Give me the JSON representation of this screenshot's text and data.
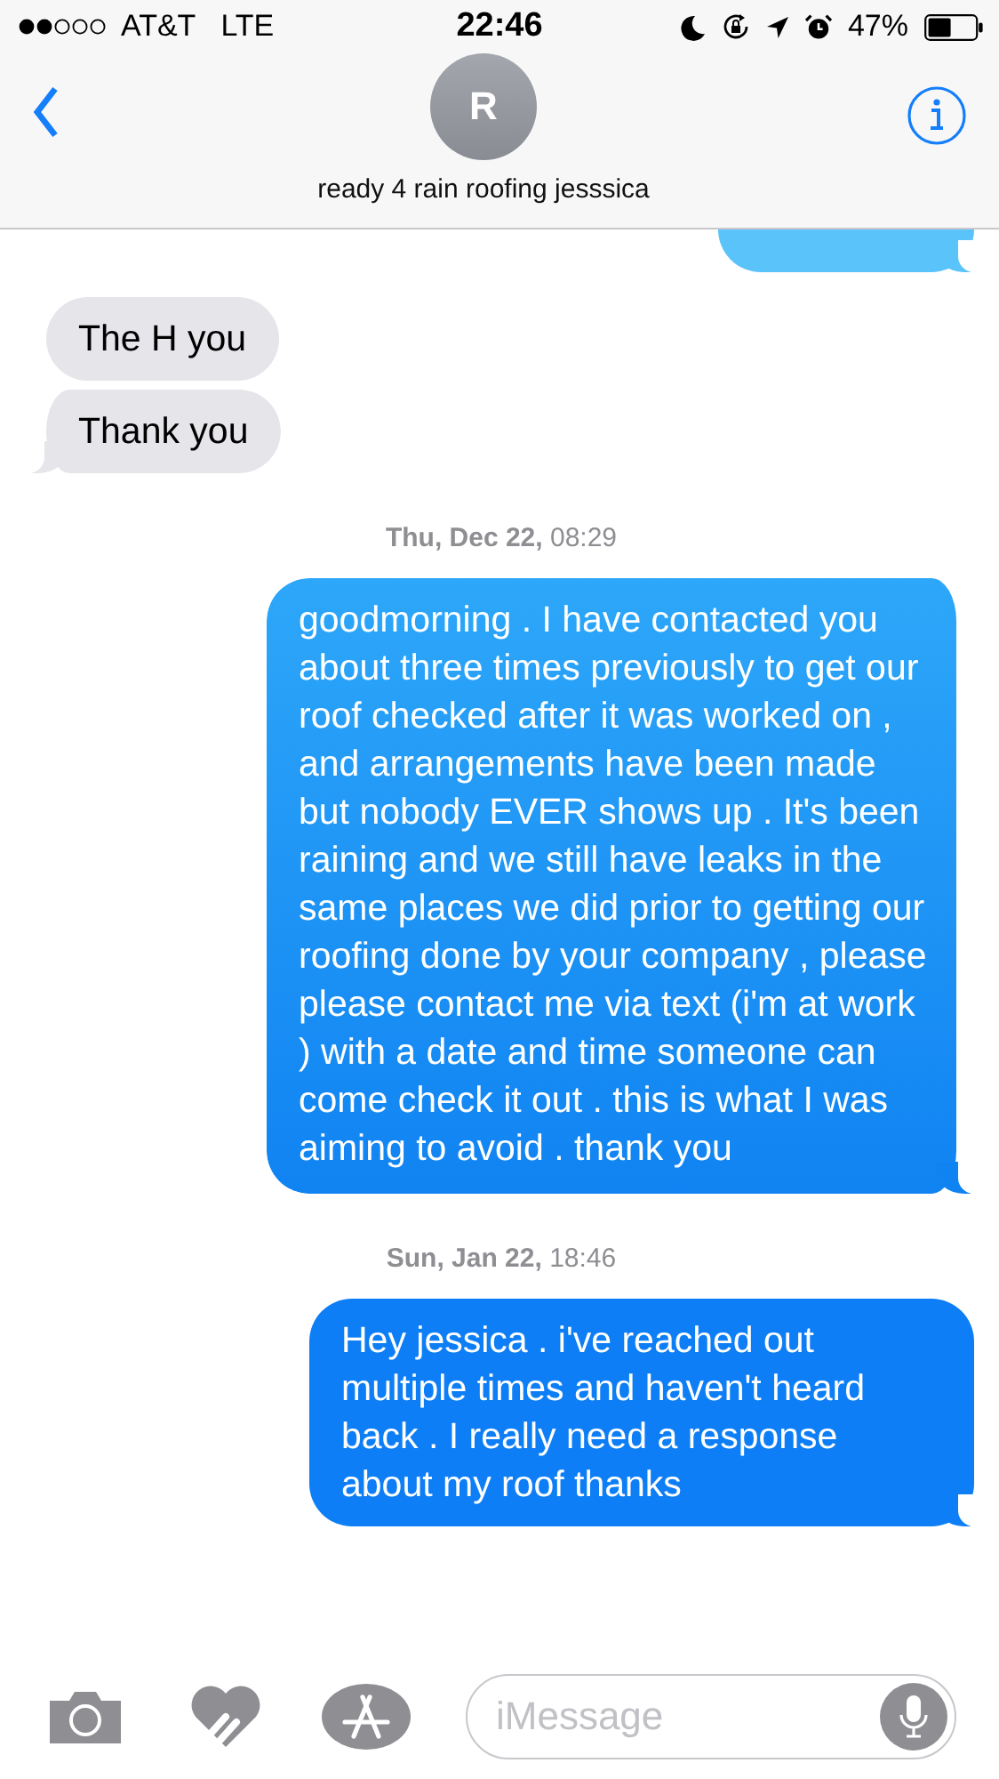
{
  "status_bar": {
    "carrier": "AT&T",
    "network": "LTE",
    "time": "22:46",
    "battery": "47%"
  },
  "header": {
    "avatar_initial": "R",
    "contact": "ready 4 rain roofing jesssica"
  },
  "messages": [
    {
      "kind": "sent_partial",
      "tail": true
    },
    {
      "kind": "received",
      "text": "The H you",
      "tail": false
    },
    {
      "kind": "received",
      "text": "Thank you",
      "tail": true
    },
    {
      "kind": "timestamp",
      "text": "**Thu, Dec 22,** 08:29"
    },
    {
      "kind": "sent",
      "text": "goodmorning . I have contacted you about three times previously to get our roof checked after it was worked on , and arrangements have been made but nobody EVER shows up . It's been raining and we still have leaks in the same places we did prior to getting our roofing done by your company , please please contact me via text (i'm at work ) with a date and time someone can come check it out . this is what I was aiming to avoid . thank you",
      "tail": true
    },
    {
      "kind": "timestamp",
      "text": "**Sun, Jan 22,** 18:46"
    },
    {
      "kind": "sent",
      "text": "Hey jessica . i've reached out multiple times and haven't heard back . I really need a response about my roof thanks",
      "tail": true
    }
  ],
  "composer": {
    "placeholder": "iMessage"
  }
}
